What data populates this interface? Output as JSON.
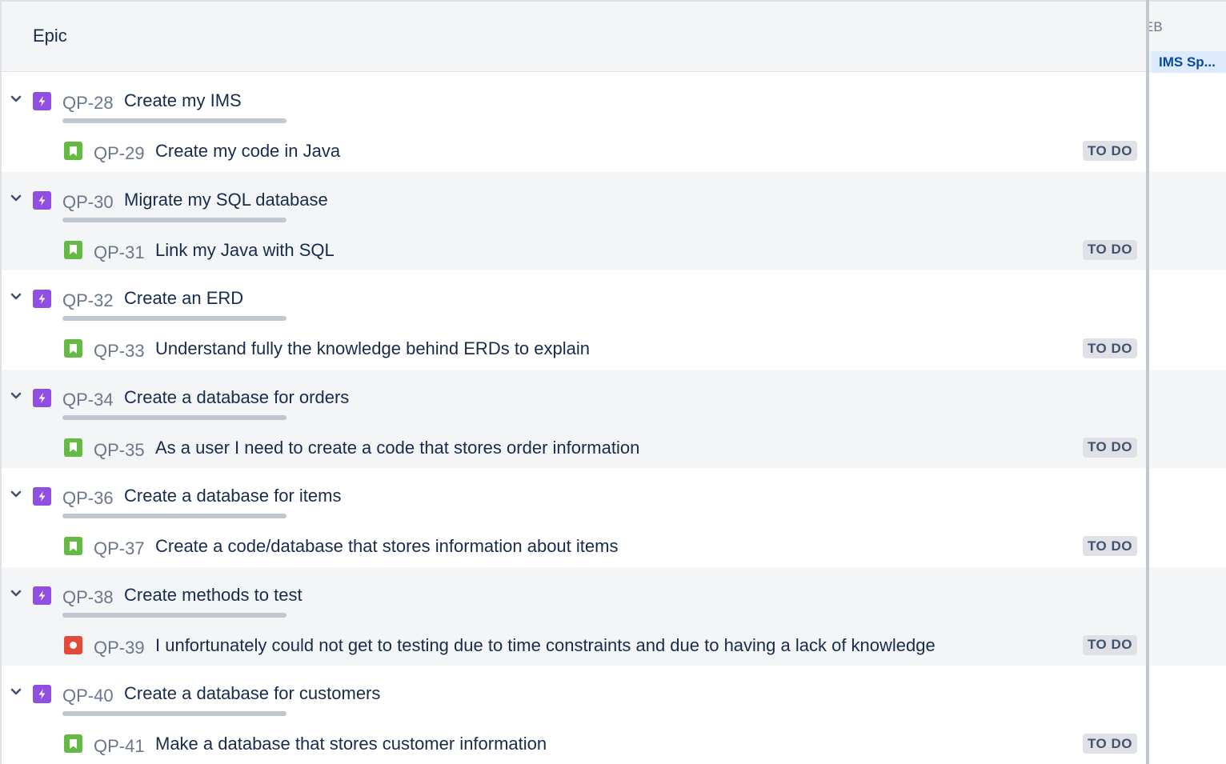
{
  "header": {
    "column_title": "Epic"
  },
  "timeline": {
    "month_label": "EB",
    "sprint_label": "IMS Sp..."
  },
  "status_colors": {
    "epic": "#904ee2",
    "story": "#65ba43",
    "bug": "#e5493a"
  },
  "groups": [
    {
      "epic": {
        "key": "QP-28",
        "title": "Create my IMS"
      },
      "child": {
        "type": "story",
        "icon": "story-bookmark-icon",
        "key": "QP-29",
        "title": "Create my code in Java",
        "status": "TO DO"
      }
    },
    {
      "epic": {
        "key": "QP-30",
        "title": "Migrate my SQL database"
      },
      "child": {
        "type": "story",
        "icon": "story-bookmark-icon",
        "key": "QP-31",
        "title": "Link my Java with SQL",
        "status": "TO DO"
      }
    },
    {
      "epic": {
        "key": "QP-32",
        "title": "Create an ERD"
      },
      "child": {
        "type": "story",
        "icon": "story-bookmark-icon",
        "key": "QP-33",
        "title": "Understand fully the knowledge behind ERDs to explain",
        "status": "TO DO"
      }
    },
    {
      "epic": {
        "key": "QP-34",
        "title": "Create a database for orders"
      },
      "child": {
        "type": "story",
        "icon": "story-bookmark-icon",
        "key": "QP-35",
        "title": "As a user I need to create a code that stores order information",
        "status": "TO DO"
      }
    },
    {
      "epic": {
        "key": "QP-36",
        "title": "Create a database for items"
      },
      "child": {
        "type": "story",
        "icon": "story-bookmark-icon",
        "key": "QP-37",
        "title": "Create a code/database that stores information about items",
        "status": "TO DO"
      }
    },
    {
      "epic": {
        "key": "QP-38",
        "title": "Create methods to test"
      },
      "child": {
        "type": "bug",
        "icon": "bug-icon",
        "key": "QP-39",
        "title": "I unfortunately could not get to testing due to time constraints and due to having a lack of knowledge",
        "status": "TO DO"
      }
    },
    {
      "epic": {
        "key": "QP-40",
        "title": "Create a database for customers"
      },
      "child": {
        "type": "story",
        "icon": "story-bookmark-icon",
        "key": "QP-41",
        "title": "Make a database that stores customer information",
        "status": "TO DO"
      }
    }
  ]
}
